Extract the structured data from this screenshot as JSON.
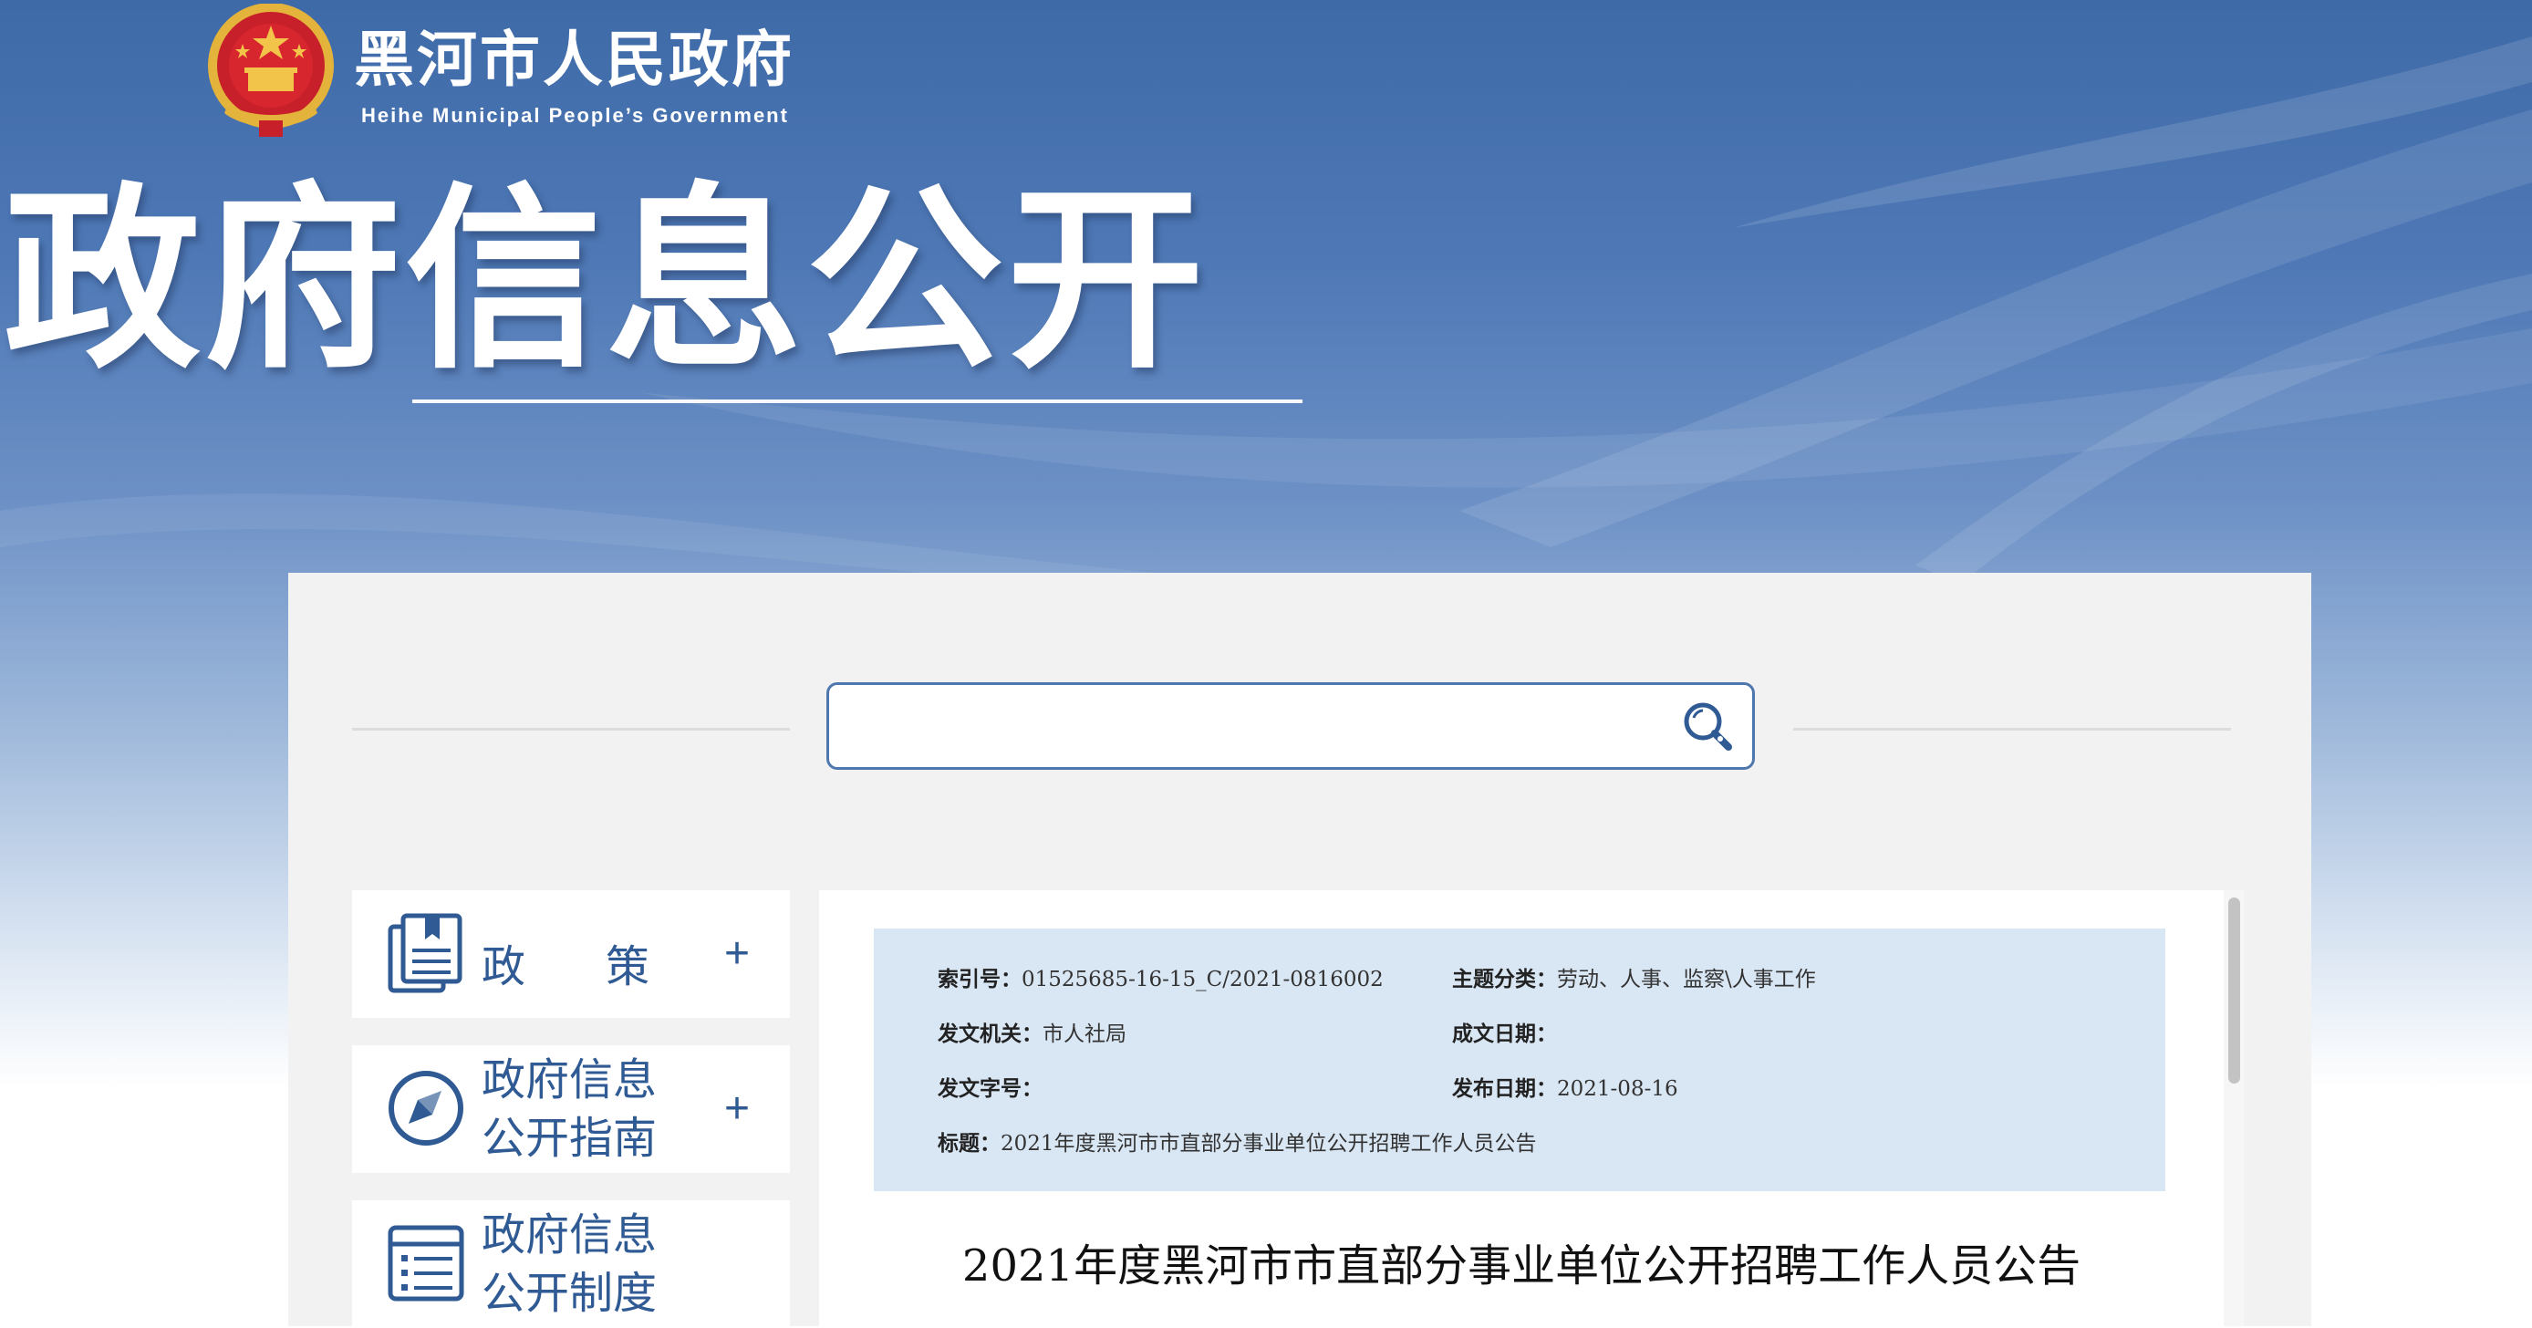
{
  "header": {
    "site_name_cn": "黑河市人民政府",
    "site_name_en": "Heihe Municipal People’s Government",
    "emblem_icon": "national-emblem-icon",
    "section_title": "政府信息公开"
  },
  "search": {
    "value": "",
    "placeholder": "",
    "button_icon": "search-icon"
  },
  "sidebar": {
    "items": [
      {
        "label": "政　策",
        "icon": "document-icon",
        "expand": "+"
      },
      {
        "label_line1": "政府信息",
        "label_line2": "公开指南",
        "icon": "compass-icon",
        "expand": "+"
      },
      {
        "label_line1": "政府信息",
        "label_line2": "公开制度",
        "icon": "list-icon"
      }
    ]
  },
  "meta": {
    "index_label": "索引号：",
    "index_value": "01525685-16-15_C/2021-0816002",
    "topic_label": "主题分类：",
    "topic_value": "劳动、人事、监察\\人事工作",
    "issuer_label": "发文机关：",
    "issuer_value": "市人社局",
    "created_label": "成文日期：",
    "created_value": "",
    "docno_label": "发文字号：",
    "docno_value": "",
    "published_label": "发布日期：",
    "published_value": "2021-08-16",
    "title_label": "标题：",
    "title_value": "2021年度黑河市市直部分事业单位公开招聘工作人员公告"
  },
  "document": {
    "title": "2021年度黑河市市直部分事业单位公开招聘工作人员公告"
  },
  "colors": {
    "accent": "#2f5a93",
    "search_border": "#4f77ae",
    "meta_bg": "#d9e6f3",
    "panel_bg": "#f2f2f2"
  }
}
